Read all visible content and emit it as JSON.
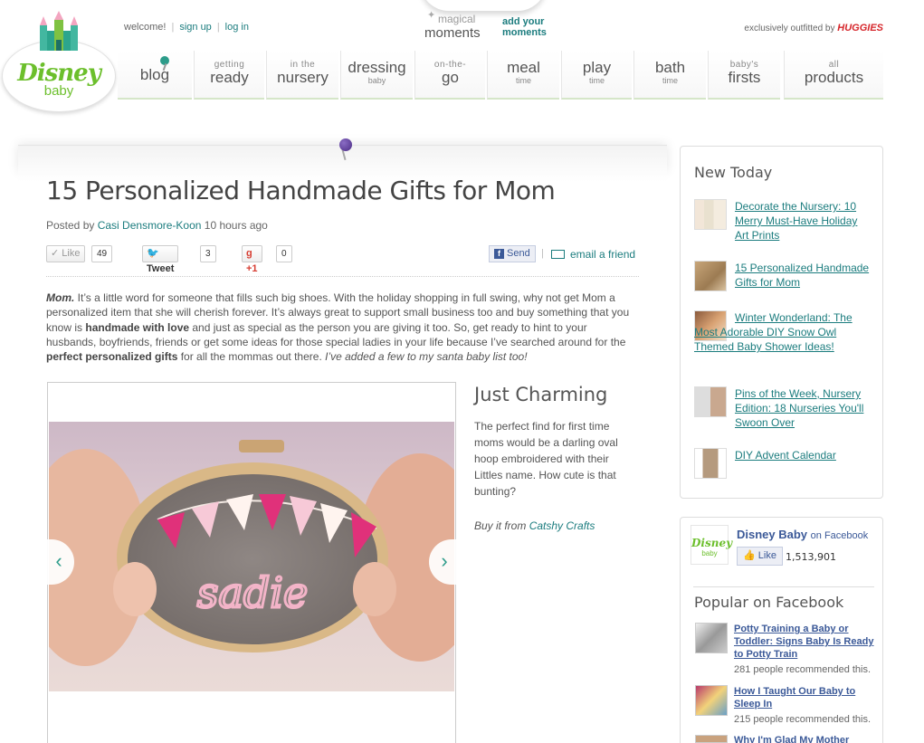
{
  "brand": {
    "logo_text": "Disney",
    "logo_sub": "baby"
  },
  "top_links": {
    "welcome": "welcome!",
    "sign_up": "sign up",
    "log_in": "log in"
  },
  "magical": {
    "line1": "magical",
    "line2": "moments",
    "add_line1": "add your",
    "add_line2": "moments"
  },
  "outfitted": {
    "prefix": "exclusively outfitted by",
    "brand": "HUGGIES"
  },
  "nav": [
    {
      "small": "",
      "big": "blog",
      "sub": ""
    },
    {
      "small": "getting",
      "big": "ready",
      "sub": ""
    },
    {
      "small": "in the",
      "big": "nursery",
      "sub": ""
    },
    {
      "small": "",
      "big": "dressing",
      "sub": "baby"
    },
    {
      "small": "on-the-",
      "big": "go",
      "sub": ""
    },
    {
      "small": "",
      "big": "meal",
      "sub": "time"
    },
    {
      "small": "",
      "big": "play",
      "sub": "time"
    },
    {
      "small": "",
      "big": "bath",
      "sub": "time"
    },
    {
      "small": "baby's",
      "big": "firsts",
      "sub": ""
    },
    {
      "small": "all",
      "big": "products",
      "sub": ""
    }
  ],
  "article": {
    "title": "15 Personalized Handmade Gifts for Mom",
    "posted_by": "Posted by",
    "author": "Casi Densmore-Koon",
    "time": "10 hours ago",
    "social": {
      "like": "Like",
      "like_count": "49",
      "tweet": "Tweet",
      "tweet_count": "3",
      "plus_one": "+1",
      "plus_count": "0",
      "send": "Send",
      "separator": "|",
      "email": "email a friend"
    },
    "intro": {
      "lead": "Mom.",
      "p1": " It’s a little word for someone that fills such big shoes. With the holiday shopping in full swing, why not get Mom a personalized item that she will cherish forever. It’s always great to support small business too and buy something that you know is ",
      "b1": "handmade with love",
      "p2": " and just as special as the person you are giving it too. So, get ready to hint to your husbands, boyfriends, friends or get some ideas for those special ladies in your life because I’ve searched around for the ",
      "b2": "perfect personalized gifts",
      "p3": " for all the mommas out there. ",
      "i1": "I’ve added a few to my santa baby list too!"
    },
    "slide": {
      "title": "Just Charming",
      "description": "The perfect find for first time moms would be a darling oval hoop embroidered with their Littles name. How cute is that bunting?",
      "buy_prefix": "Buy it from",
      "buy_link": "Catshy Crafts",
      "embroidered_name": "sadie"
    }
  },
  "new_today": {
    "title": "New Today",
    "items": [
      {
        "text": "Decorate the Nursery: 10 Merry Must-Have Holiday Art Prints"
      },
      {
        "text": "15 Personalized Handmade Gifts for Mom"
      },
      {
        "text": "Winter Wonderland: The Most Adorable DIY Snow Owl Themed Baby Shower Ideas!"
      },
      {
        "text": "Pins of the Week, Nursery Edition: 18 Nurseries You'll Swoon Over"
      },
      {
        "text": "DIY Advent Calendar"
      }
    ]
  },
  "facebook": {
    "page_name": "Disney Baby",
    "on": "on Facebook",
    "like": "Like",
    "count": "1,513,901",
    "popular_title": "Popular on Facebook",
    "popular": [
      {
        "title": "Potty Training a Baby or Toddler: Signs Baby Is Ready to Potty Train",
        "rec": "281 people recommended this."
      },
      {
        "title": "How I Taught Our Baby to Sleep In",
        "rec": "215 people recommended this."
      },
      {
        "title": "Why I'm Glad My Mother",
        "rec": ""
      }
    ]
  },
  "colors": {
    "accent": "#1b7c7e",
    "brand_green": "#6cbf2c",
    "facebook_blue": "#3b5998",
    "huggies_red": "#d6262b"
  }
}
